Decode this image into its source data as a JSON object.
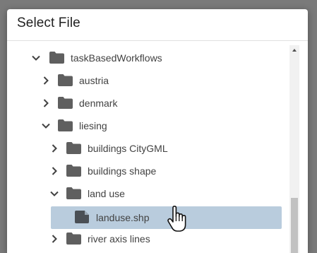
{
  "dialog": {
    "title": "Select File"
  },
  "tree": {
    "items": [
      {
        "label": "taskBasedWorkflows",
        "type": "folder",
        "expanded": true
      },
      {
        "label": "austria",
        "type": "folder",
        "expanded": false
      },
      {
        "label": "denmark",
        "type": "folder",
        "expanded": false
      },
      {
        "label": "liesing",
        "type": "folder",
        "expanded": true
      },
      {
        "label": "buildings CityGML",
        "type": "folder",
        "expanded": false
      },
      {
        "label": "buildings shape",
        "type": "folder",
        "expanded": false
      },
      {
        "label": "land use",
        "type": "folder",
        "expanded": true
      },
      {
        "label": "landuse.shp",
        "type": "file",
        "selected": true
      },
      {
        "label": "river axis lines",
        "type": "folder",
        "expanded": false
      }
    ]
  },
  "colors": {
    "selection": "#b9ccdd",
    "folder_icon": "#5f5f5f",
    "text": "#424242",
    "backdrop": "#7a7a7a"
  },
  "icons": {
    "expanded": "chevron-down-icon",
    "collapsed": "chevron-right-icon",
    "folder": "folder-icon",
    "file": "file-icon",
    "cursor": "hand-pointer-icon"
  }
}
